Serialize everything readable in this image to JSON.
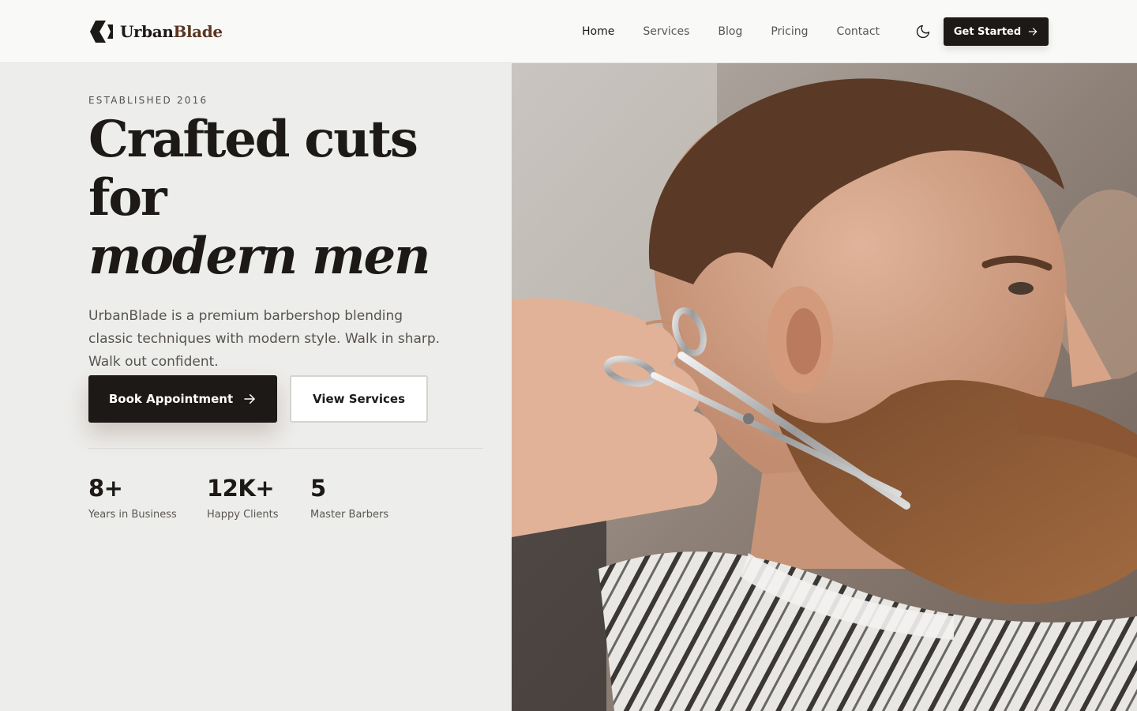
{
  "brand": {
    "name_part1": "Urban",
    "name_part2": "Blade",
    "logo_icon": "urbanblade-logo-icon",
    "colors": {
      "primary": "#1c1917",
      "accent": "#5b3520",
      "background": "#ededeb"
    }
  },
  "nav": {
    "items": [
      {
        "label": "Home",
        "active": true
      },
      {
        "label": "Services",
        "active": false
      },
      {
        "label": "Blog",
        "active": false
      },
      {
        "label": "Pricing",
        "active": false
      },
      {
        "label": "Contact",
        "active": false
      }
    ],
    "theme_toggle_icon": "moon-icon",
    "cta_label": "Get Started",
    "cta_icon": "arrow-right-icon"
  },
  "hero": {
    "eyebrow": "ESTABLISHED 2016",
    "title_line1": "Crafted cuts",
    "title_line2": "for",
    "title_line3": "modern men",
    "description": "UrbanBlade is a premium barbershop blending classic techniques with modern style. Walk in sharp. Walk out confident.",
    "primary_button": "Book Appointment",
    "primary_button_icon": "arrow-right-icon",
    "secondary_button": "View Services",
    "image_subject": "barber trimming a bearded man's beard with scissors"
  },
  "stats": [
    {
      "value": "8+",
      "label": "Years in Business"
    },
    {
      "value": "12K+",
      "label": "Happy Clients"
    },
    {
      "value": "5",
      "label": "Master Barbers"
    }
  ]
}
